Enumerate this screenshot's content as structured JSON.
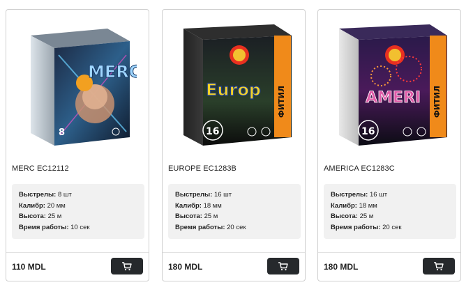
{
  "products": [
    {
      "name": "MERC EC12112",
      "image_label": "MERC",
      "image_count": "8",
      "theme_color": "#3a8fd0",
      "specs": [
        {
          "label": "Выстрелы:",
          "value": "8 шт"
        },
        {
          "label": "Калибр:",
          "value": "20 мм"
        },
        {
          "label": "Высота:",
          "value": "25 м"
        },
        {
          "label": "Время работы:",
          "value": "10 сек"
        }
      ],
      "price": "110 MDL"
    },
    {
      "name": "EUROPE EC1283B",
      "image_label": "Europ",
      "image_count": "16",
      "image_side_text": "ФИТИЛ",
      "theme_color": "#f0c020",
      "specs": [
        {
          "label": "Выстрелы:",
          "value": "16 шт"
        },
        {
          "label": "Калибр:",
          "value": "18 мм"
        },
        {
          "label": "Высота:",
          "value": "25 м"
        },
        {
          "label": "Время работы:",
          "value": "20 сек"
        }
      ],
      "price": "180 MDL"
    },
    {
      "name": "AMERICA EC1283C",
      "image_label": "AMERI",
      "image_count": "16",
      "image_side_text": "ФИТИЛ",
      "theme_color": "#d02070",
      "specs": [
        {
          "label": "Выстрелы:",
          "value": "16 шт"
        },
        {
          "label": "Калибр:",
          "value": "18 мм"
        },
        {
          "label": "Высота:",
          "value": "25 м"
        },
        {
          "label": "Время работы:",
          "value": "20 сек"
        }
      ],
      "price": "180 MDL"
    }
  ],
  "icons": {
    "cart": "shopping-cart-icon"
  }
}
